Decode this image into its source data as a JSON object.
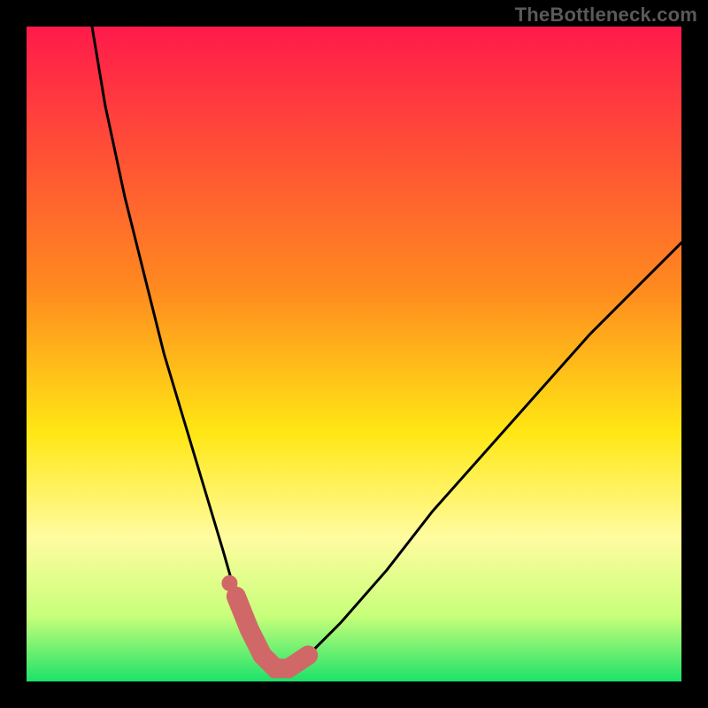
{
  "watermark": "TheBottleneck.com",
  "colors": {
    "curve": "#000000",
    "sweet_spot": "#d06868",
    "gradient_stops": [
      {
        "offset": "0%",
        "color": "#ff1a4b"
      },
      {
        "offset": "40%",
        "color": "#ff8a1f"
      },
      {
        "offset": "62%",
        "color": "#ffe714"
      },
      {
        "offset": "78%",
        "color": "#fffca0"
      },
      {
        "offset": "90%",
        "color": "#c8ff7a"
      },
      {
        "offset": "100%",
        "color": "#1de26a"
      }
    ]
  },
  "chart_data": {
    "type": "line",
    "title": "",
    "xlabel": "",
    "ylabel": "",
    "xlim": [
      0,
      100
    ],
    "ylim": [
      0,
      100
    ],
    "y_axis_inverted_note": "y=0 (bottom) is best/green; y=100 (top) is worst/red",
    "series": [
      {
        "name": "bottleneck_curve",
        "x": [
          10,
          12,
          15,
          18,
          21,
          24,
          27,
          30,
          32,
          34,
          36,
          38,
          40,
          43,
          48,
          55,
          62,
          70,
          78,
          86,
          94,
          100
        ],
        "y": [
          100,
          88,
          74,
          62,
          50,
          40,
          30,
          20,
          13,
          8,
          4,
          2,
          2,
          4,
          9,
          17,
          26,
          35,
          44,
          53,
          61,
          67
        ]
      }
    ],
    "sweet_spot": {
      "x_range": [
        32,
        43
      ],
      "dot_x": 31,
      "dot_y": 15
    },
    "annotations": []
  }
}
